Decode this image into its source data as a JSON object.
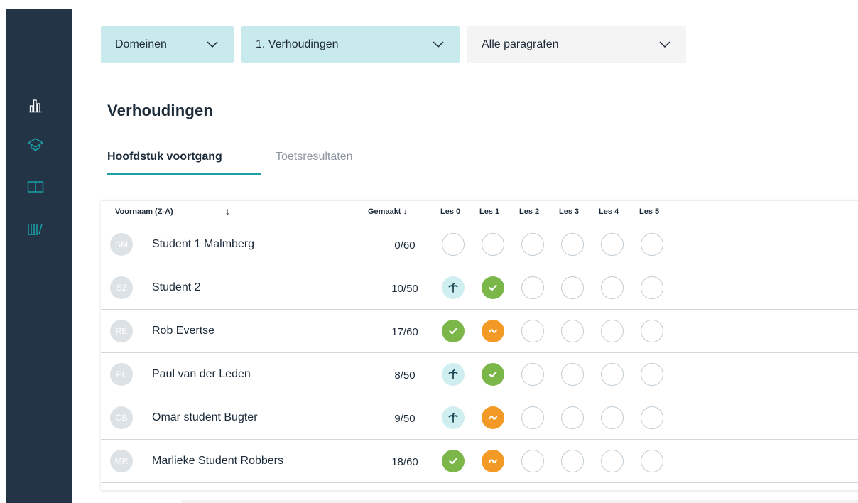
{
  "sidebar": {
    "items": [
      {
        "icon": "bar-chart-icon",
        "active": false
      },
      {
        "icon": "graduation-cap-icon",
        "active": true
      },
      {
        "icon": "book-icon",
        "active": false
      },
      {
        "icon": "library-icon",
        "active": false
      }
    ]
  },
  "filters": {
    "domain": "Domeinen",
    "chapter": "1. Verhoudingen",
    "paragraph": "Alle paragrafen"
  },
  "page": {
    "title": "Verhoudingen"
  },
  "tabs": [
    {
      "label": "Hoofdstuk voortgang",
      "active": true
    },
    {
      "label": "Toetsresultaten",
      "active": false
    }
  ],
  "table": {
    "headers": {
      "name": "Voornaam (Z-A)",
      "name_sort": "↓",
      "made": "Gemaakt ↓",
      "lessons": [
        "Les 0",
        "Les 1",
        "Les 2",
        "Les 3",
        "Les 4",
        "Les 5"
      ]
    },
    "rows": [
      {
        "initials": "SM",
        "name": "Student 1 Malmberg",
        "made": "0/60",
        "lessons": [
          "empty",
          "empty",
          "empty",
          "empty",
          "empty",
          "empty"
        ]
      },
      {
        "initials": "S2",
        "name": "Student 2",
        "made": "10/50",
        "lessons": [
          "vacation",
          "done",
          "empty",
          "empty",
          "empty",
          "empty"
        ]
      },
      {
        "initials": "RE",
        "name": "Rob Evertse",
        "made": "17/60",
        "lessons": [
          "done",
          "partial",
          "empty",
          "empty",
          "empty",
          "empty"
        ]
      },
      {
        "initials": "PL",
        "name": "Paul van der Leden",
        "made": "8/50",
        "lessons": [
          "vacation",
          "done",
          "empty",
          "empty",
          "empty",
          "empty"
        ]
      },
      {
        "initials": "OB",
        "name": "Omar student Bugter",
        "made": "9/50",
        "lessons": [
          "vacation",
          "partial",
          "empty",
          "empty",
          "empty",
          "empty"
        ]
      },
      {
        "initials": "MR",
        "name": "Marlieke Student Robbers",
        "made": "18/60",
        "lessons": [
          "done",
          "partial",
          "empty",
          "empty",
          "empty",
          "empty"
        ]
      }
    ]
  },
  "colors": {
    "sidebar": "#233446",
    "accent": "#1aa1a8",
    "done": "#7ab648",
    "partial": "#f39a26",
    "vacation_bg": "#cfeef0",
    "vacation_fg": "#1b4a55",
    "empty_ring": "#c3ccd3"
  }
}
